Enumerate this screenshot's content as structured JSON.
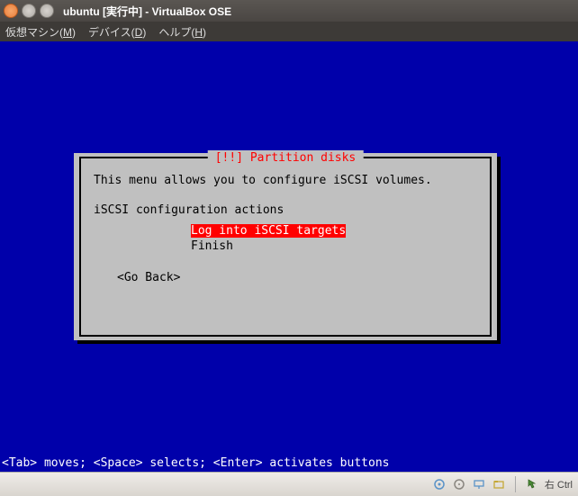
{
  "titlebar": {
    "title": "ubuntu [実行中] - VirtualBox OSE"
  },
  "menubar": {
    "items": [
      {
        "label": "仮想マシン",
        "accel": "M"
      },
      {
        "label": "デバイス",
        "accel": "D"
      },
      {
        "label": "ヘルプ",
        "accel": "H"
      }
    ]
  },
  "dialog": {
    "title": "[!!] Partition disks",
    "intro": "This menu allows you to configure iSCSI volumes.",
    "prompt": "iSCSI configuration actions",
    "options": [
      {
        "label": "Log into iSCSI targets",
        "selected": true
      },
      {
        "label": "Finish",
        "selected": false
      }
    ],
    "go_back": "<Go Back>"
  },
  "helpbar": "<Tab> moves; <Space> selects; <Enter> activates buttons",
  "statusbar": {
    "host_key": "右 Ctrl"
  }
}
